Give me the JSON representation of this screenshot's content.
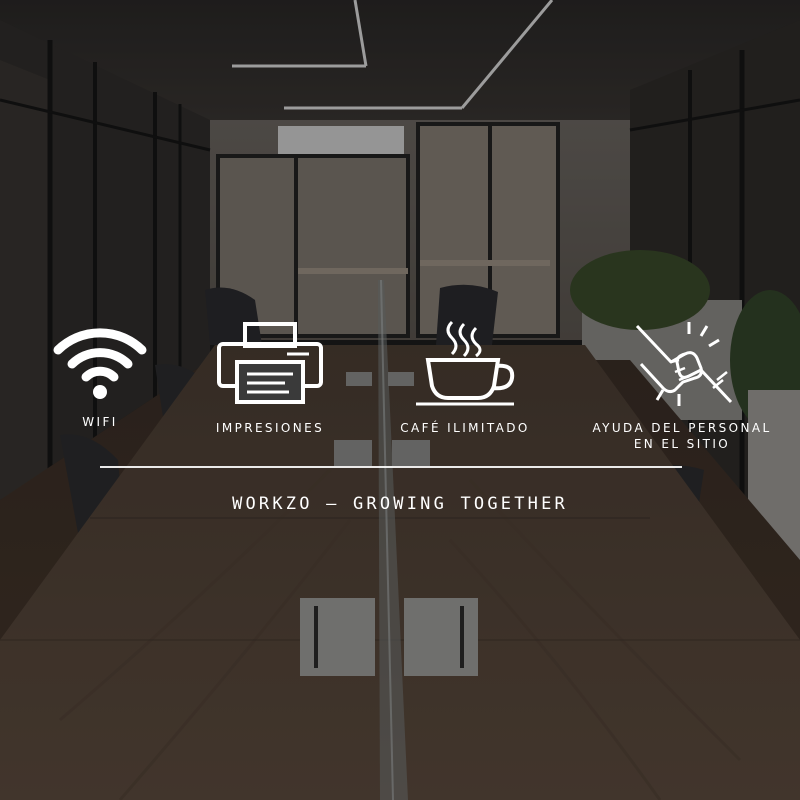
{
  "features": [
    {
      "icon": "wifi-icon",
      "label": "WIFI"
    },
    {
      "icon": "printer-icon",
      "label": "IMPRESIONES"
    },
    {
      "icon": "coffee-cup-icon",
      "label": "CAFÉ ILIMITADO"
    },
    {
      "icon": "helping-hands-icon",
      "label_line1": "AYUDA DEL PERSONAL",
      "label_line2": "EN EL SITIO"
    }
  ],
  "tagline": "WORKZO – GROWING TOGETHER",
  "colors": {
    "text": "#ffffff",
    "overlay": "#1a1a1a",
    "table_wood": "#5a4a3c",
    "floor_wood": "#4a3a2e"
  }
}
